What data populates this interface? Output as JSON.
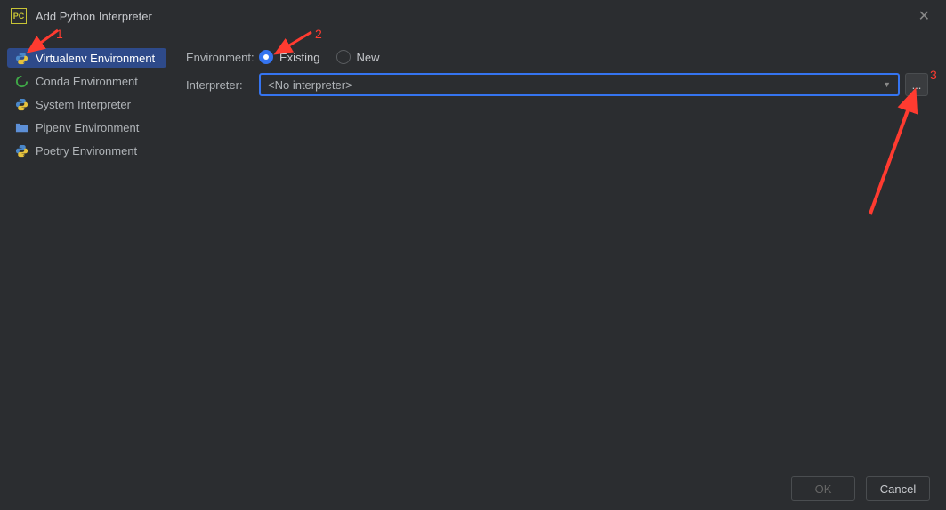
{
  "header": {
    "title": "Add Python Interpreter"
  },
  "sidebar": {
    "items": [
      {
        "label": "Virtualenv Environment",
        "icon": "python-icon",
        "selected": true
      },
      {
        "label": "Conda Environment",
        "icon": "conda-icon",
        "selected": false
      },
      {
        "label": "System Interpreter",
        "icon": "python-icon",
        "selected": false
      },
      {
        "label": "Pipenv Environment",
        "icon": "folder-icon",
        "selected": false
      },
      {
        "label": "Poetry Environment",
        "icon": "python-icon",
        "selected": false
      }
    ]
  },
  "form": {
    "environment_label": "Environment:",
    "interpreter_label": "Interpreter:",
    "radio_existing": "Existing",
    "radio_new": "New",
    "interpreter_value": "<No interpreter>",
    "browse_label": "..."
  },
  "buttons": {
    "ok": "OK",
    "cancel": "Cancel"
  },
  "annotations": {
    "label1": "1",
    "label2": "2",
    "label3": "3"
  }
}
